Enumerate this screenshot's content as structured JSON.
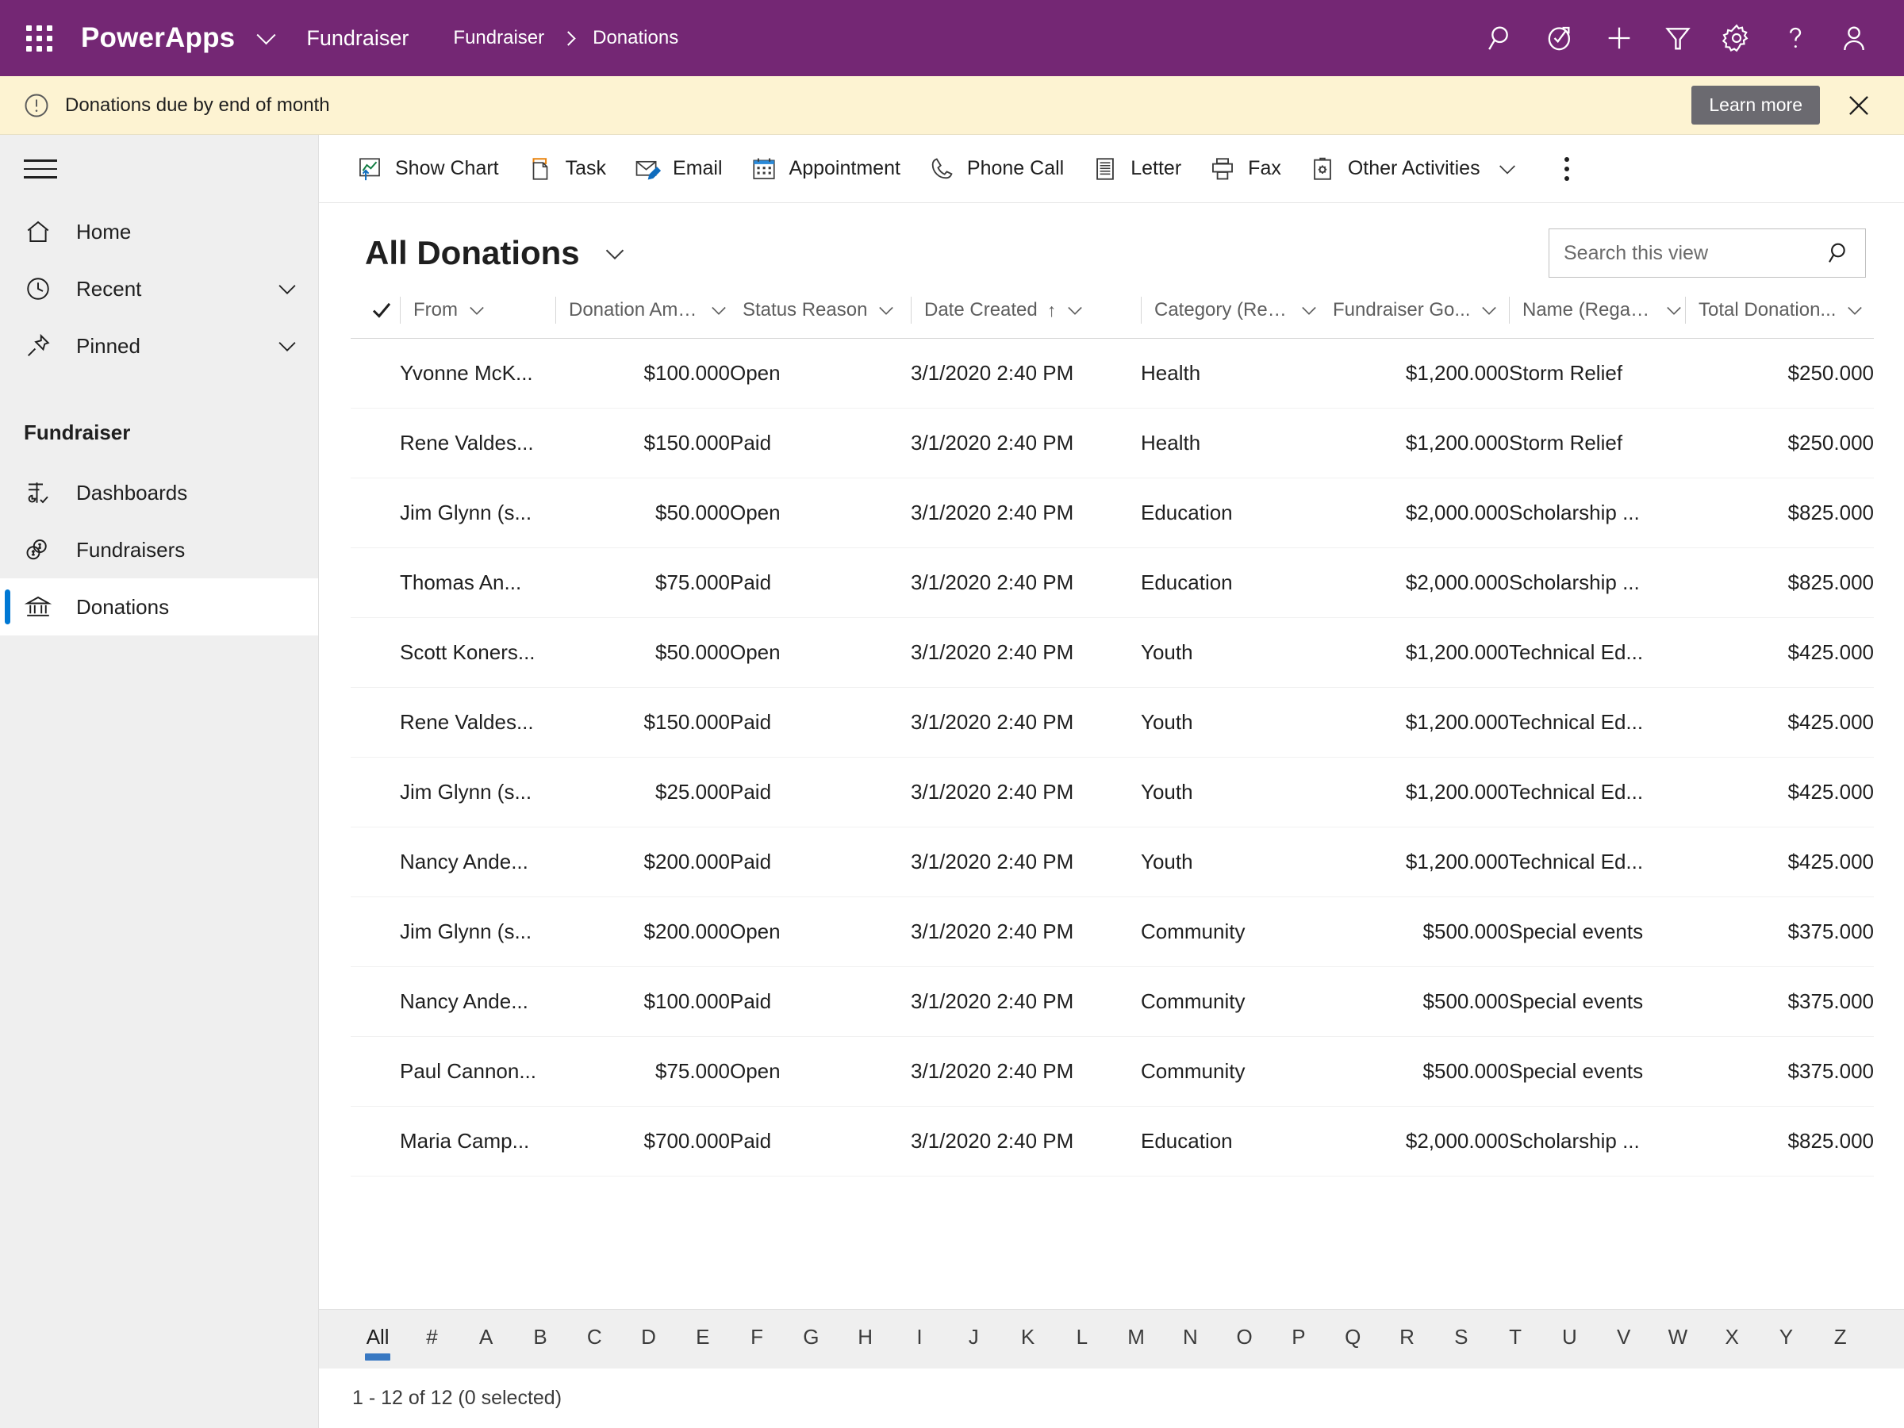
{
  "header": {
    "waffle_icon": "app-launcher-icon",
    "brand": "PowerApps",
    "brand_chevron_icon": "chevron-down-icon",
    "app_name": "Fundraiser",
    "breadcrumb": {
      "parent": "Fundraiser",
      "current": "Donations"
    },
    "icons": [
      {
        "name": "search-icon",
        "label": "Search"
      },
      {
        "name": "assistant-icon",
        "label": "Assistant"
      },
      {
        "name": "plus-icon",
        "label": "Quick create"
      },
      {
        "name": "filter-icon",
        "label": "Filter"
      },
      {
        "name": "gear-icon",
        "label": "Settings"
      },
      {
        "name": "help-icon",
        "label": "Help"
      },
      {
        "name": "person-icon",
        "label": "Account"
      }
    ]
  },
  "notification": {
    "icon": "exclamation-circle-icon",
    "message": "Donations due by end of month",
    "action_label": "Learn more",
    "close_icon": "close-icon",
    "background": "#fdf3d2"
  },
  "sidebar": {
    "hamburger_icon": "hamburger-icon",
    "top_items": [
      {
        "label": "Home",
        "icon": "home-icon",
        "expandable": false
      },
      {
        "label": "Recent",
        "icon": "clock-icon",
        "expandable": true
      },
      {
        "label": "Pinned",
        "icon": "pin-icon",
        "expandable": true
      }
    ],
    "group_label": "Fundraiser",
    "group_items": [
      {
        "label": "Dashboards",
        "icon": "dashboard-icon",
        "selected": false
      },
      {
        "label": "Fundraisers",
        "icon": "money-icon",
        "selected": false
      },
      {
        "label": "Donations",
        "icon": "bank-icon",
        "selected": true
      }
    ],
    "selection_color": "#0078d4"
  },
  "commandbar": {
    "items": [
      {
        "label": "Show Chart",
        "icon": "show-chart-icon",
        "has_chevron": false
      },
      {
        "label": "Task",
        "icon": "task-icon",
        "has_chevron": false
      },
      {
        "label": "Email",
        "icon": "email-icon",
        "has_chevron": false
      },
      {
        "label": "Appointment",
        "icon": "appointment-icon",
        "has_chevron": false
      },
      {
        "label": "Phone Call",
        "icon": "phone-icon",
        "has_chevron": false
      },
      {
        "label": "Letter",
        "icon": "letter-icon",
        "has_chevron": false
      },
      {
        "label": "Fax",
        "icon": "fax-icon",
        "has_chevron": false
      },
      {
        "label": "Other Activities",
        "icon": "other-activities-icon",
        "has_chevron": true
      }
    ],
    "overflow_icon": "more-vertical-icon"
  },
  "view": {
    "title": "All Donations",
    "title_chevron_icon": "chevron-down-icon",
    "search": {
      "placeholder": "Search this view",
      "value": "",
      "icon": "search-icon"
    }
  },
  "grid": {
    "select_all_icon": "checkmark-icon",
    "columns": [
      {
        "label": "From",
        "align": "left",
        "sorted": false
      },
      {
        "label": "Donation Amo...",
        "align": "right",
        "sorted": false
      },
      {
        "label": "Status Reason",
        "align": "left",
        "sorted": false
      },
      {
        "label": "Date Created",
        "align": "left",
        "sorted": true,
        "sort_dir": "↑"
      },
      {
        "label": "Category (Reg...",
        "align": "left",
        "sorted": false
      },
      {
        "label": "Fundraiser Go...",
        "align": "right",
        "sorted": false
      },
      {
        "label": "Name (Regard...",
        "align": "left",
        "sorted": false
      },
      {
        "label": "Total Donation...",
        "align": "right",
        "sorted": false
      }
    ],
    "rows": [
      [
        "Yvonne McK...",
        "$100.000",
        "Open",
        "3/1/2020 2:40 PM",
        "Health",
        "$1,200.000",
        "Storm Relief",
        "$250.000"
      ],
      [
        "Rene Valdes...",
        "$150.000",
        "Paid",
        "3/1/2020 2:40 PM",
        "Health",
        "$1,200.000",
        "Storm Relief",
        "$250.000"
      ],
      [
        "Jim Glynn (s...",
        "$50.000",
        "Open",
        "3/1/2020 2:40 PM",
        "Education",
        "$2,000.000",
        "Scholarship ...",
        "$825.000"
      ],
      [
        "Thomas An...",
        "$75.000",
        "Paid",
        "3/1/2020 2:40 PM",
        "Education",
        "$2,000.000",
        "Scholarship ...",
        "$825.000"
      ],
      [
        "Scott Koners...",
        "$50.000",
        "Open",
        "3/1/2020 2:40 PM",
        "Youth",
        "$1,200.000",
        "Technical Ed...",
        "$425.000"
      ],
      [
        "Rene Valdes...",
        "$150.000",
        "Paid",
        "3/1/2020 2:40 PM",
        "Youth",
        "$1,200.000",
        "Technical Ed...",
        "$425.000"
      ],
      [
        "Jim Glynn (s...",
        "$25.000",
        "Paid",
        "3/1/2020 2:40 PM",
        "Youth",
        "$1,200.000",
        "Technical Ed...",
        "$425.000"
      ],
      [
        "Nancy Ande...",
        "$200.000",
        "Paid",
        "3/1/2020 2:40 PM",
        "Youth",
        "$1,200.000",
        "Technical Ed...",
        "$425.000"
      ],
      [
        "Jim Glynn (s...",
        "$200.000",
        "Open",
        "3/1/2020 2:40 PM",
        "Community",
        "$500.000",
        "Special events",
        "$375.000"
      ],
      [
        "Nancy Ande...",
        "$100.000",
        "Paid",
        "3/1/2020 2:40 PM",
        "Community",
        "$500.000",
        "Special events",
        "$375.000"
      ],
      [
        "Paul Cannon...",
        "$75.000",
        "Open",
        "3/1/2020 2:40 PM",
        "Community",
        "$500.000",
        "Special events",
        "$375.000"
      ],
      [
        "Maria Camp...",
        "$700.000",
        "Paid",
        "3/1/2020 2:40 PM",
        "Education",
        "$2,000.000",
        "Scholarship ...",
        "$825.000"
      ]
    ]
  },
  "alphabar": {
    "selected": "All",
    "items": [
      "All",
      "#",
      "A",
      "B",
      "C",
      "D",
      "E",
      "F",
      "G",
      "H",
      "I",
      "J",
      "K",
      "L",
      "M",
      "N",
      "O",
      "P",
      "Q",
      "R",
      "S",
      "T",
      "U",
      "V",
      "W",
      "X",
      "Y",
      "Z"
    ],
    "indicator_color": "#3878c2"
  },
  "footer": {
    "status": "1 - 12 of 12 (0 selected)"
  },
  "colors": {
    "brand_purple": "#742774",
    "accent_blue": "#0078d4",
    "notif_bg": "#fdf3d2",
    "sidebar_bg": "#efefef"
  }
}
